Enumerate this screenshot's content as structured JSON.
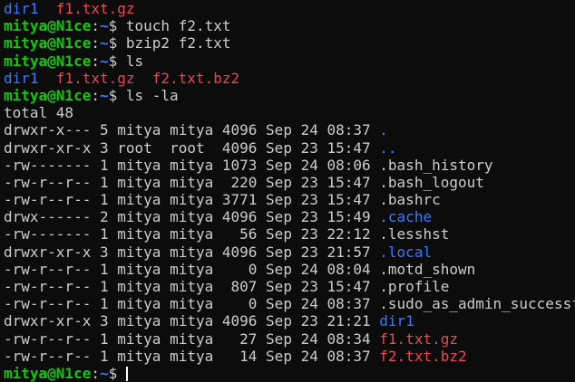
{
  "window": {
    "prompt": {
      "user_host": "mitya@N1ce",
      "sep": ":",
      "cwd": "~",
      "symbol": "$"
    },
    "lines": [
      {
        "type": "ls",
        "entries": [
          {
            "name": "dir1",
            "kind": "dir"
          },
          {
            "name": "f1.txt.gz",
            "kind": "archive"
          }
        ]
      },
      {
        "type": "cmd",
        "command": "touch f2.txt"
      },
      {
        "type": "cmd",
        "command": "bzip2 f2.txt"
      },
      {
        "type": "cmd",
        "command": "ls"
      },
      {
        "type": "ls",
        "entries": [
          {
            "name": "dir1",
            "kind": "dir"
          },
          {
            "name": "f1.txt.gz",
            "kind": "archive"
          },
          {
            "name": "f2.txt.bz2",
            "kind": "archive"
          }
        ]
      },
      {
        "type": "cmd",
        "command": "ls -la"
      },
      {
        "type": "text",
        "text": "total 48"
      },
      {
        "type": "entry",
        "perms": "drwxr-x---",
        "links": "5",
        "owner": "mitya",
        "group": "mitya",
        "size": "4096",
        "date": "Sep 24 08:37",
        "name": ".",
        "kind": "dir"
      },
      {
        "type": "entry",
        "perms": "drwxr-xr-x",
        "links": "3",
        "owner": "root ",
        "group": "root ",
        "size": "4096",
        "date": "Sep 23 15:47",
        "name": "..",
        "kind": "dir"
      },
      {
        "type": "entry",
        "perms": "-rw-------",
        "links": "1",
        "owner": "mitya",
        "group": "mitya",
        "size": "1073",
        "date": "Sep 24 08:06",
        "name": ".bash_history",
        "kind": "file"
      },
      {
        "type": "entry",
        "perms": "-rw-r--r--",
        "links": "1",
        "owner": "mitya",
        "group": "mitya",
        "size": " 220",
        "date": "Sep 23 15:47",
        "name": ".bash_logout",
        "kind": "file"
      },
      {
        "type": "entry",
        "perms": "-rw-r--r--",
        "links": "1",
        "owner": "mitya",
        "group": "mitya",
        "size": "3771",
        "date": "Sep 23 15:47",
        "name": ".bashrc",
        "kind": "file"
      },
      {
        "type": "entry",
        "perms": "drwx------",
        "links": "2",
        "owner": "mitya",
        "group": "mitya",
        "size": "4096",
        "date": "Sep 23 15:49",
        "name": ".cache",
        "kind": "dir"
      },
      {
        "type": "entry",
        "perms": "-rw-------",
        "links": "1",
        "owner": "mitya",
        "group": "mitya",
        "size": "  56",
        "date": "Sep 23 22:12",
        "name": ".lesshst",
        "kind": "file"
      },
      {
        "type": "entry",
        "perms": "drwxr-xr-x",
        "links": "3",
        "owner": "mitya",
        "group": "mitya",
        "size": "4096",
        "date": "Sep 23 21:57",
        "name": ".local",
        "kind": "dir"
      },
      {
        "type": "entry",
        "perms": "-rw-r--r--",
        "links": "1",
        "owner": "mitya",
        "group": "mitya",
        "size": "   0",
        "date": "Sep 24 08:04",
        "name": ".motd_shown",
        "kind": "file"
      },
      {
        "type": "entry",
        "perms": "-rw-r--r--",
        "links": "1",
        "owner": "mitya",
        "group": "mitya",
        "size": " 807",
        "date": "Sep 23 15:47",
        "name": ".profile",
        "kind": "file"
      },
      {
        "type": "entry",
        "perms": "-rw-r--r--",
        "links": "1",
        "owner": "mitya",
        "group": "mitya",
        "size": "   0",
        "date": "Sep 24 08:37",
        "name": ".sudo_as_admin_successful",
        "kind": "file"
      },
      {
        "type": "entry",
        "perms": "drwxr-xr-x",
        "links": "3",
        "owner": "mitya",
        "group": "mitya",
        "size": "4096",
        "date": "Sep 23 21:21",
        "name": "dir1",
        "kind": "dir"
      },
      {
        "type": "entry",
        "perms": "-rw-r--r--",
        "links": "1",
        "owner": "mitya",
        "group": "mitya",
        "size": "  27",
        "date": "Sep 24 08:34",
        "name": "f1.txt.gz",
        "kind": "archive"
      },
      {
        "type": "entry",
        "perms": "-rw-r--r--",
        "links": "1",
        "owner": "mitya",
        "group": "mitya",
        "size": "  14",
        "date": "Sep 24 08:37",
        "name": "f2.txt.bz2",
        "kind": "archive"
      },
      {
        "type": "prompt"
      }
    ]
  },
  "colors": {
    "background": "#0c0c0c",
    "text": "#cccccc",
    "prompt_user": "#16c60c",
    "directory": "#3b78ff",
    "archive": "#e74856"
  }
}
